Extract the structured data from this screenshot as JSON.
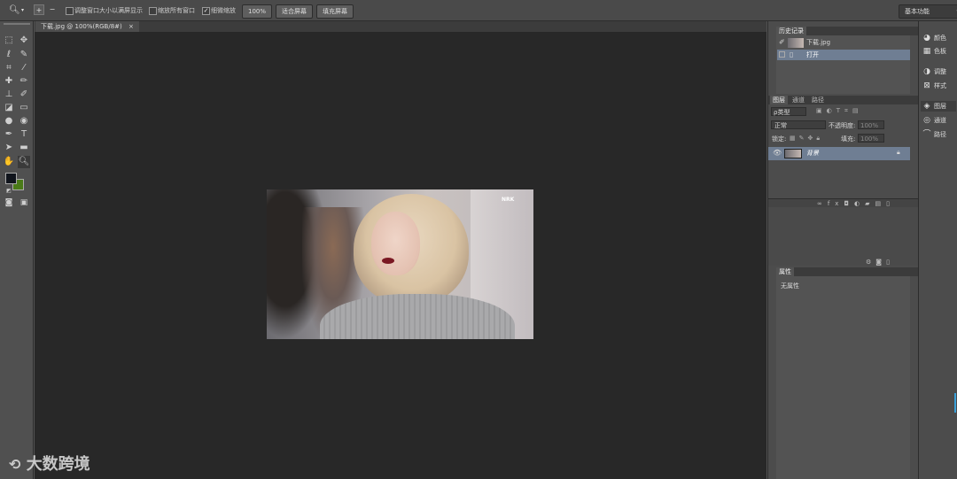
{
  "options_bar": {
    "resize_windows_label": "调整窗口大小以满屏显示",
    "zoom_all_label": "缩放所有窗口",
    "scrubby_zoom_label": "细微缩放",
    "btn_100": "100%",
    "btn_fit": "适合屏幕",
    "btn_fill": "填充屏幕",
    "workspace": "基本功能"
  },
  "document": {
    "tab_title": "下载.jpg @ 100%(RGB/8#)",
    "image_logo": "NRK"
  },
  "history": {
    "tab": "历史记录",
    "snapshot": "下载.jpg",
    "items": [
      "打开"
    ]
  },
  "layers": {
    "tabs": [
      "图层",
      "通道",
      "路径"
    ],
    "filter_kind": "ρ类型",
    "blend_mode": "正常",
    "opacity_label": "不透明度:",
    "opacity_value": "100%",
    "lock_label": "锁定:",
    "fill_label": "填充:",
    "fill_value": "100%",
    "layer_name": "背景"
  },
  "properties": {
    "tab": "属性",
    "content": "无属性"
  },
  "right_panel": {
    "items": [
      "颜色",
      "色板",
      "调整",
      "样式",
      "图层",
      "通道",
      "路径"
    ]
  },
  "watermark": "大数跨境"
}
